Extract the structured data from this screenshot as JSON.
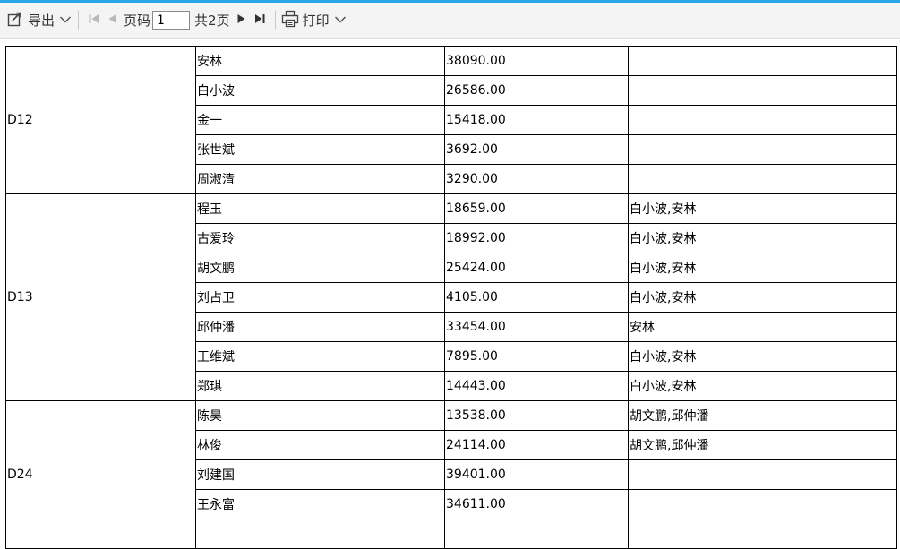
{
  "toolbar": {
    "export_label": "导出",
    "page_label": "页码",
    "page_value": "1",
    "total_pages": "共2页",
    "print_label": "打印"
  },
  "report": {
    "groups": [
      {
        "code": "D12",
        "rows": [
          {
            "name": "安林",
            "amount": "38090.00",
            "related": ""
          },
          {
            "name": "白小波",
            "amount": "26586.00",
            "related": ""
          },
          {
            "name": "金一",
            "amount": "15418.00",
            "related": ""
          },
          {
            "name": "张世斌",
            "amount": "3692.00",
            "related": ""
          },
          {
            "name": "周淑清",
            "amount": "3290.00",
            "related": ""
          }
        ]
      },
      {
        "code": "D13",
        "rows": [
          {
            "name": "程玉",
            "amount": "18659.00",
            "related": "白小波,安林"
          },
          {
            "name": "古爱玲",
            "amount": "18992.00",
            "related": "白小波,安林"
          },
          {
            "name": "胡文鹏",
            "amount": "25424.00",
            "related": "白小波,安林"
          },
          {
            "name": "刘占卫",
            "amount": "4105.00",
            "related": "白小波,安林"
          },
          {
            "name": "邱仲潘",
            "amount": "33454.00",
            "related": "安林"
          },
          {
            "name": "王维斌",
            "amount": "7895.00",
            "related": "白小波,安林"
          },
          {
            "name": "郑琪",
            "amount": "14443.00",
            "related": "白小波,安林"
          }
        ]
      },
      {
        "code": "D24",
        "rows": [
          {
            "name": "陈昊",
            "amount": "13538.00",
            "related": "胡文鹏,邱仲潘"
          },
          {
            "name": "林俊",
            "amount": "24114.00",
            "related": "胡文鹏,邱仲潘"
          },
          {
            "name": "刘建国",
            "amount": "39401.00",
            "related": ""
          },
          {
            "name": "王永富",
            "amount": "34611.00",
            "related": ""
          }
        ]
      }
    ]
  }
}
